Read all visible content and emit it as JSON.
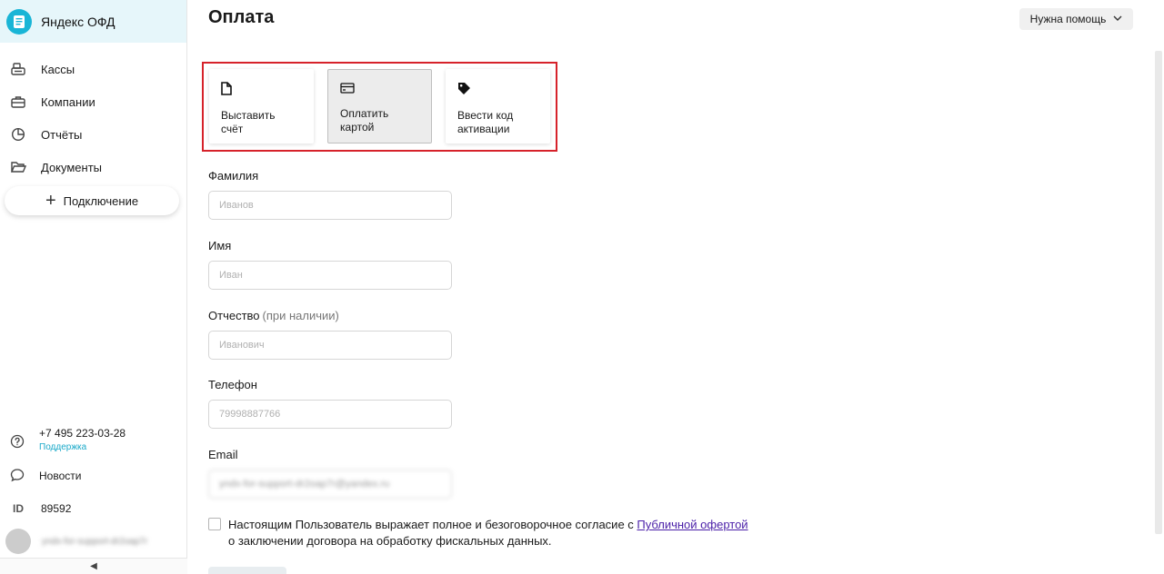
{
  "app": {
    "title": "Яндекс ОФД"
  },
  "sidebar": {
    "items": [
      {
        "label": "Кассы",
        "icon": "cash-register-icon"
      },
      {
        "label": "Компании",
        "icon": "briefcase-icon"
      },
      {
        "label": "Отчёты",
        "icon": "pie-chart-icon"
      },
      {
        "label": "Документы",
        "icon": "folder-icon"
      }
    ],
    "connect_label": "Подключение",
    "support_phone": "+7 495 223-03-28",
    "support_label": "Поддержка",
    "news_label": "Новости",
    "id_label": "ID",
    "id_value": "89592",
    "user_name": "yndx-for-support-dr2oap7r"
  },
  "header": {
    "title": "Оплата",
    "help_label": "Нужна помощь"
  },
  "payment_methods": [
    {
      "label": "Выставить счёт",
      "icon": "document-icon",
      "active": false
    },
    {
      "label": "Оплатить картой",
      "icon": "card-icon",
      "active": true
    },
    {
      "label": "Ввести код активации",
      "icon": "tag-icon",
      "active": false
    }
  ],
  "form": {
    "last_name": {
      "label": "Фамилия",
      "placeholder": "Иванов"
    },
    "first_name": {
      "label": "Имя",
      "placeholder": "Иван"
    },
    "middle_name": {
      "label": "Отчество",
      "hint": "(при наличии)",
      "placeholder": "Иванович"
    },
    "phone": {
      "label": "Телефон",
      "placeholder": "79998887766"
    },
    "email": {
      "label": "Email",
      "value": "yndx-for-support-dr2oap7r@yandex.ru"
    }
  },
  "consent": {
    "text_before": "Настоящим Пользователь выражает полное и безоговорочное согласие с ",
    "link_text": "Публичной офертой",
    "text_after": "о заключении договора на обработку фискальных данных."
  },
  "colors": {
    "accent": "#19b5d6",
    "highlight_border": "#d6222a",
    "link": "#4a1fa8"
  }
}
